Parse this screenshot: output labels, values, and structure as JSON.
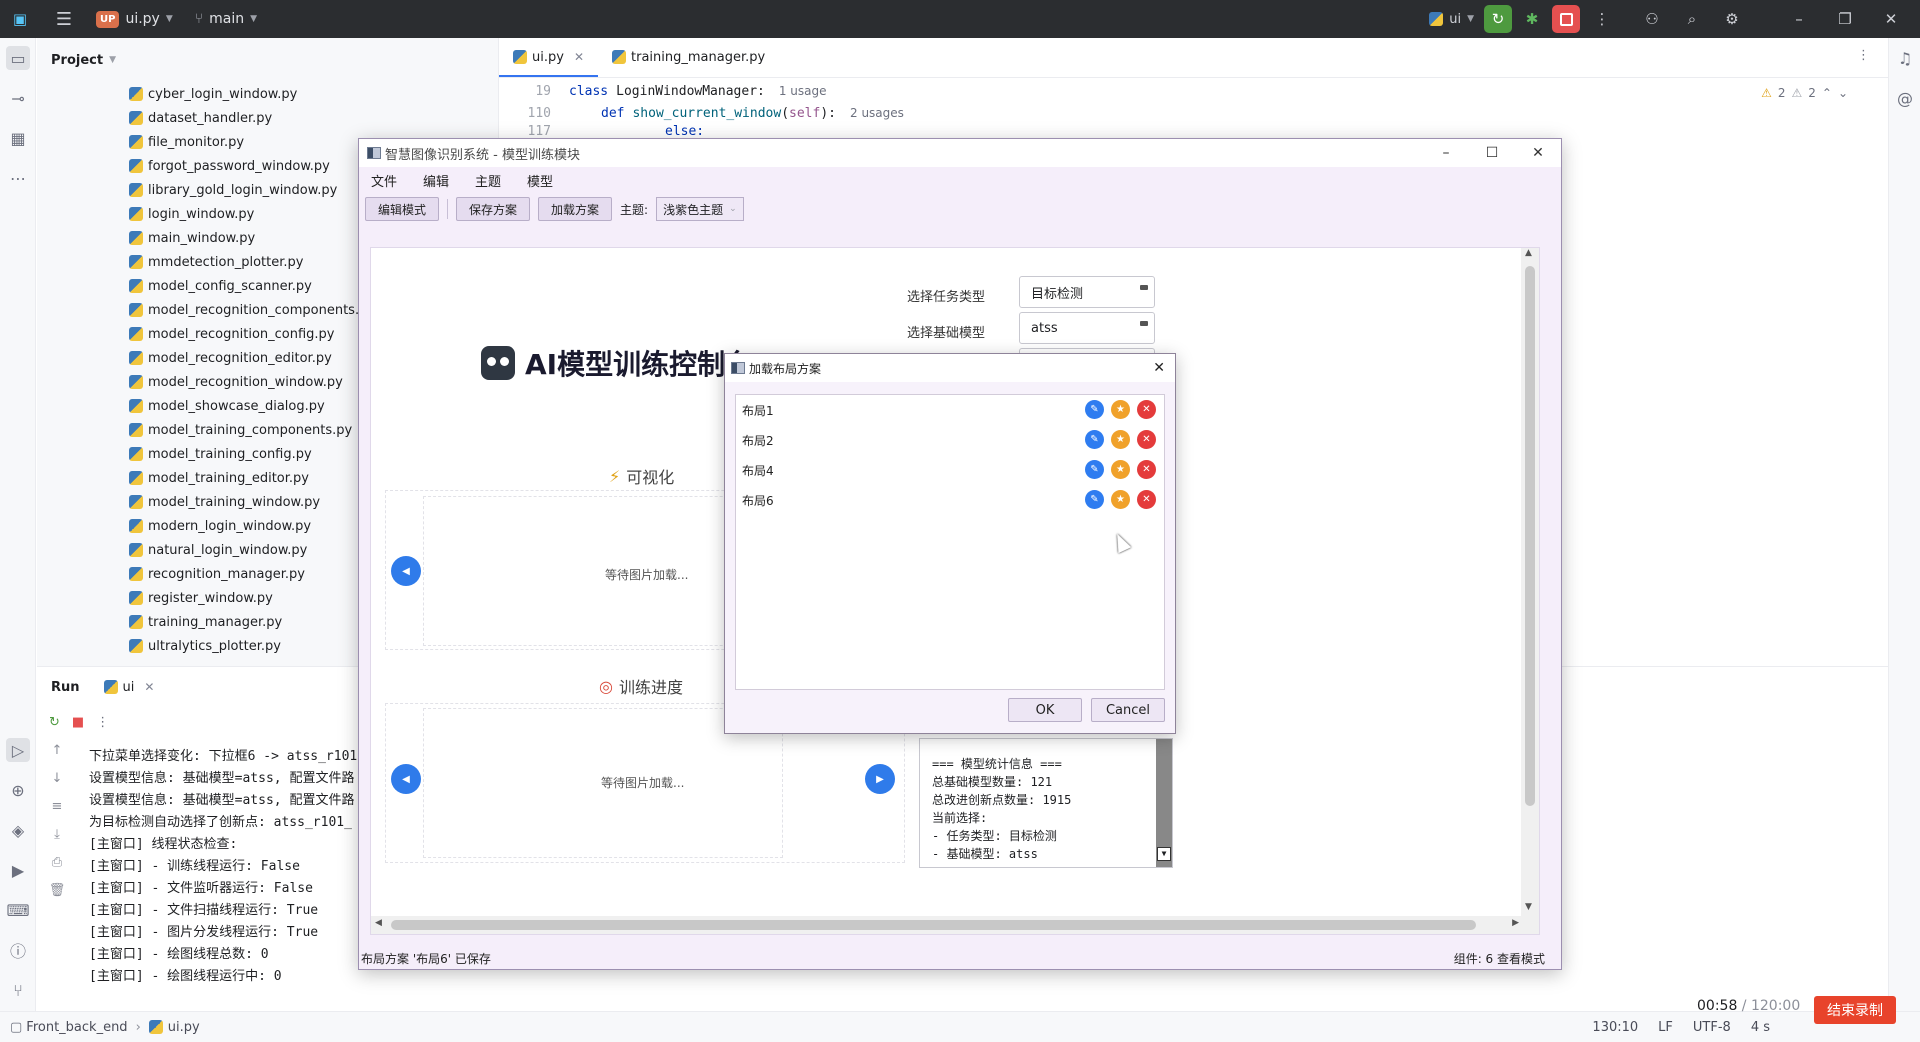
{
  "ide": {
    "project_badge": "UP",
    "project_name": "ui.py",
    "branch": "main",
    "run_config": "ui",
    "project_panel_title": "Project",
    "files": [
      "cyber_login_window.py",
      "dataset_handler.py",
      "file_monitor.py",
      "forgot_password_window.py",
      "library_gold_login_window.py",
      "login_window.py",
      "main_window.py",
      "mmdetection_plotter.py",
      "model_config_scanner.py",
      "model_recognition_components.py",
      "model_recognition_config.py",
      "model_recognition_editor.py",
      "model_recognition_window.py",
      "model_showcase_dialog.py",
      "model_training_components.py",
      "model_training_config.py",
      "model_training_editor.py",
      "model_training_window.py",
      "modern_login_window.py",
      "natural_login_window.py",
      "recognition_manager.py",
      "register_window.py",
      "training_manager.py",
      "ultralytics_plotter.py"
    ],
    "tabs": [
      "ui.py",
      "training_manager.py"
    ],
    "code": {
      "line1_num": "19",
      "line1_kw": "class",
      "line1_name": "LoginWindowManager",
      "line1_colon": ":",
      "line1_hint": "1 usage",
      "line2_num": "110",
      "line2_kw": "def",
      "line2_name": "show_current_window",
      "line2_paren_open": "(",
      "line2_self": "self",
      "line2_paren_close": "):",
      "line2_hint": "2 usages",
      "line3_num": "117",
      "line3_kw": "else:"
    },
    "warnings": {
      "a": "2",
      "b": "2"
    },
    "run_panel": {
      "title": "Run",
      "tab": "ui",
      "console": [
        "下拉菜单选择变化: 下拉框6 -> atss_r101",
        "设置模型信息: 基础模型=atss, 配置文件路",
        "设置模型信息: 基础模型=atss, 配置文件路",
        "为目标检测自动选择了创新点: atss_r101_",
        "[主窗口] 线程状态检查:",
        "[主窗口] - 训练线程运行: False",
        "[主窗口] - 文件监听器运行: False",
        "[主窗口] - 文件扫描线程运行: True",
        "[主窗口] - 图片分发线程运行: True",
        "[主窗口] - 绘图线程总数: 0",
        "[主窗口] - 绘图线程运行中: 0"
      ]
    },
    "status_bar": {
      "breadcrumb_root": "Front_back_end",
      "breadcrumb_file": "ui.py",
      "position": "130:10",
      "line_sep": "LF",
      "encoding": "UTF-8",
      "indent": "4 s"
    }
  },
  "recording": {
    "elapsed": "00:58",
    "total": " / 120:00",
    "stop_label": "结束录制"
  },
  "app": {
    "title": "智慧图像识别系统 - 模型训练模块",
    "menu": [
      "文件",
      "编辑",
      "主题",
      "模型"
    ],
    "toolbar": {
      "edit_mode": "编辑模式",
      "save_scheme": "保存方案",
      "load_scheme": "加载方案",
      "theme_label": "主题:",
      "theme_value": "浅紫色主题"
    },
    "heading": "AI模型训练控制台",
    "task_type_label": "选择任务类型",
    "task_type_value": "目标检测",
    "base_model_label": "选择基础模型",
    "base_model_value": "atss",
    "section_visual": "可视化",
    "section_progress": "训练进度",
    "waiting_text_1": "等待图片加载...",
    "waiting_text_2": "等待图片加载...",
    "stats_lines": [
      "=== 模型统计信息 ===",
      "总基础模型数量: 121",
      "总改进创新点数量: 1915",
      "当前选择:",
      "- 任务类型: 目标检测",
      "- 基础模型: atss"
    ],
    "status_left": "布局方案 '布局6' 已保存",
    "status_right": "组件: 6  查看模式"
  },
  "dialog": {
    "title": "加载布局方案",
    "layouts": [
      "布局1",
      "布局2",
      "布局4",
      "布局6"
    ],
    "ok": "OK",
    "cancel": "Cancel"
  },
  "colors": {
    "ide_dark": "#2b2d30",
    "accent_blue": "#3574f0",
    "app_purple_bg": "#f5eefa",
    "action_edit": "#2e7cf0",
    "action_star": "#f0a12a",
    "action_delete": "#e43b3b",
    "record_red": "#e8432b"
  }
}
